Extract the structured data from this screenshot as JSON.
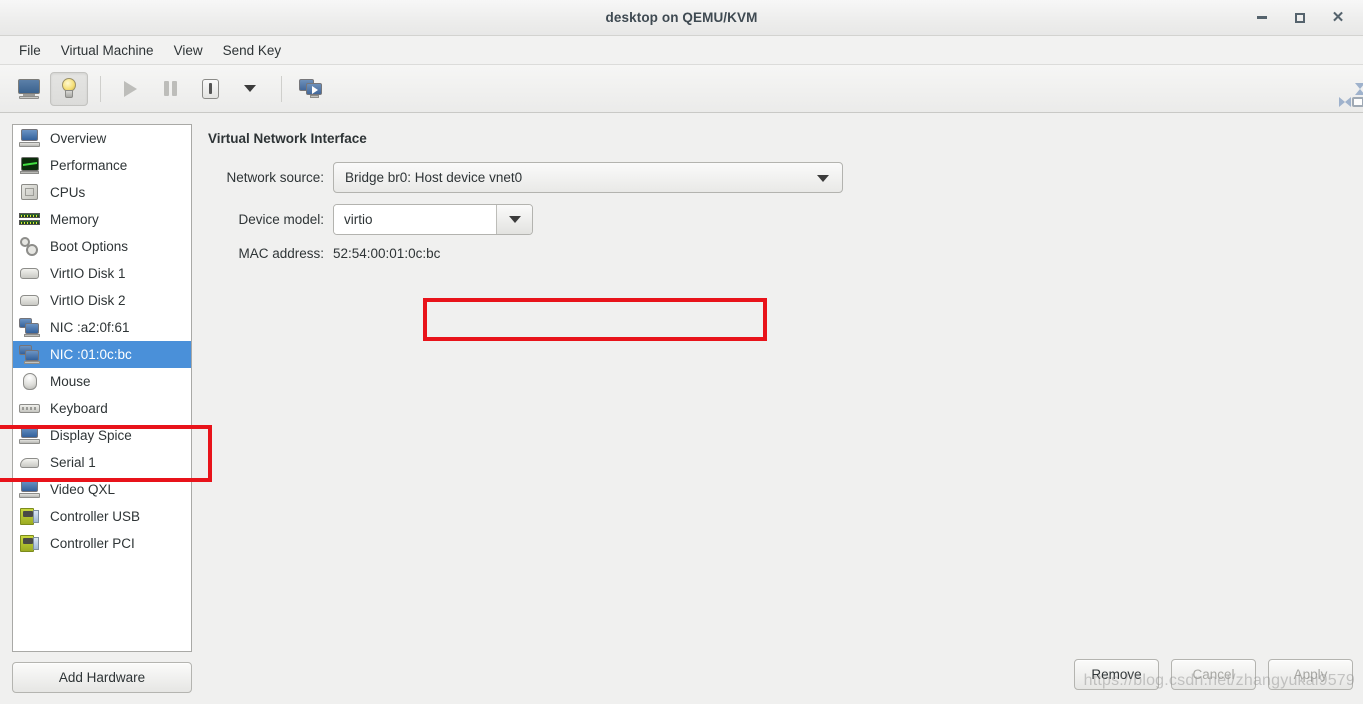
{
  "window": {
    "title": "desktop on QEMU/KVM",
    "controls": {
      "minimize": "–",
      "maximize": "□",
      "close": "✕"
    }
  },
  "menubar": {
    "items": [
      {
        "label": "File"
      },
      {
        "label": "Virtual Machine"
      },
      {
        "label": "View"
      },
      {
        "label": "Send Key"
      }
    ]
  },
  "toolbar": {
    "buttons": [
      {
        "name": "show-console-button",
        "icon": "monitor-icon",
        "active": false
      },
      {
        "name": "show-details-button",
        "icon": "lightbulb-icon",
        "active": true
      },
      {
        "name": "run-button",
        "icon": "play-icon",
        "active": false,
        "disabled": true
      },
      {
        "name": "pause-button",
        "icon": "pause-icon",
        "active": false,
        "disabled": true
      },
      {
        "name": "shutdown-button",
        "icon": "power-icon",
        "active": false
      },
      {
        "name": "shutdown-menu-button",
        "icon": "chevron-down-icon",
        "active": false
      },
      {
        "name": "snapshots-button",
        "icon": "multi-screen-icon",
        "active": false
      }
    ],
    "right_button": {
      "name": "fullscreen-button",
      "icon": "fullscreen-arrows-icon"
    }
  },
  "sidebar": {
    "items": [
      {
        "label": "Overview",
        "icon": "monitor-icon",
        "selected": false
      },
      {
        "label": "Performance",
        "icon": "performance-icon",
        "selected": false
      },
      {
        "label": "CPUs",
        "icon": "cpu-icon",
        "selected": false
      },
      {
        "label": "Memory",
        "icon": "memory-icon",
        "selected": false
      },
      {
        "label": "Boot Options",
        "icon": "gears-icon",
        "selected": false
      },
      {
        "label": "VirtIO Disk 1",
        "icon": "disk-icon",
        "selected": false
      },
      {
        "label": "VirtIO Disk 2",
        "icon": "disk-icon",
        "selected": false
      },
      {
        "label": "NIC :a2:0f:61",
        "icon": "nic-icon",
        "selected": false
      },
      {
        "label": "NIC :01:0c:bc",
        "icon": "nic-icon",
        "selected": true
      },
      {
        "label": "Mouse",
        "icon": "mouse-icon",
        "selected": false
      },
      {
        "label": "Keyboard",
        "icon": "keyboard-icon",
        "selected": false
      },
      {
        "label": "Display Spice",
        "icon": "monitor-icon",
        "selected": false
      },
      {
        "label": "Serial 1",
        "icon": "serial-icon",
        "selected": false
      },
      {
        "label": "Video QXL",
        "icon": "monitor-icon",
        "selected": false
      },
      {
        "label": "Controller USB",
        "icon": "controller-icon",
        "selected": false
      },
      {
        "label": "Controller PCI",
        "icon": "controller-icon",
        "selected": false
      }
    ],
    "add_hardware_label": "Add Hardware"
  },
  "main": {
    "panel_title": "Virtual Network Interface",
    "network_source": {
      "label": "Network source:",
      "value": "Bridge br0: Host device vnet0"
    },
    "device_model": {
      "label": "Device model:",
      "value": "virtio"
    },
    "mac_address": {
      "label": "MAC address:",
      "value": "52:54:00:01:0c:bc"
    }
  },
  "footer": {
    "remove_label": "Remove",
    "cancel_label": "Cancel",
    "apply_label": "Apply"
  },
  "watermark": {
    "text": "https://blog.csdn.net/zhangyukai9579"
  },
  "colors": {
    "selection_blue": "#4a90d9",
    "highlight_red": "#e8131a",
    "window_bg": "#f0f0ef",
    "list_bg": "#ffffff",
    "text": "#2e3436"
  }
}
